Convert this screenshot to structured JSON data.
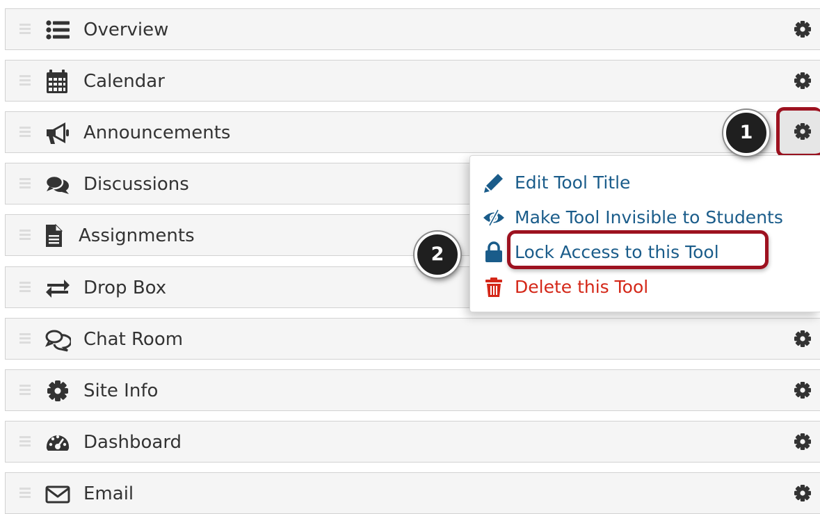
{
  "tools": [
    {
      "label": "Overview",
      "icon": "list-icon"
    },
    {
      "label": "Calendar",
      "icon": "calendar-icon"
    },
    {
      "label": "Announcements",
      "icon": "megaphone-icon"
    },
    {
      "label": "Discussions",
      "icon": "comments-icon"
    },
    {
      "label": "Assignments",
      "icon": "document-icon"
    },
    {
      "label": "Drop Box",
      "icon": "exchange-icon"
    },
    {
      "label": "Chat Room",
      "icon": "chat-bubbles-icon"
    },
    {
      "label": "Site Info",
      "icon": "gear-icon"
    },
    {
      "label": "Dashboard",
      "icon": "dashboard-icon"
    },
    {
      "label": "Email",
      "icon": "envelope-icon"
    }
  ],
  "settings_icon": "gear-icon",
  "dropdown": {
    "items": [
      {
        "label": "Edit Tool Title",
        "icon": "pencil-icon",
        "style": "link"
      },
      {
        "label": "Make Tool Invisible to Students",
        "icon": "eye-slash-icon",
        "style": "link"
      },
      {
        "label": "Lock Access to this Tool",
        "icon": "lock-icon",
        "style": "link"
      },
      {
        "label": "Delete this Tool",
        "icon": "trash-icon",
        "style": "danger"
      }
    ]
  },
  "callouts": [
    "1",
    "2"
  ],
  "colors": {
    "link": "#1a5c8a",
    "danger": "#d42718",
    "highlight": "#9d1220",
    "row_background": "#f5f5f5",
    "icon": "#333333"
  }
}
